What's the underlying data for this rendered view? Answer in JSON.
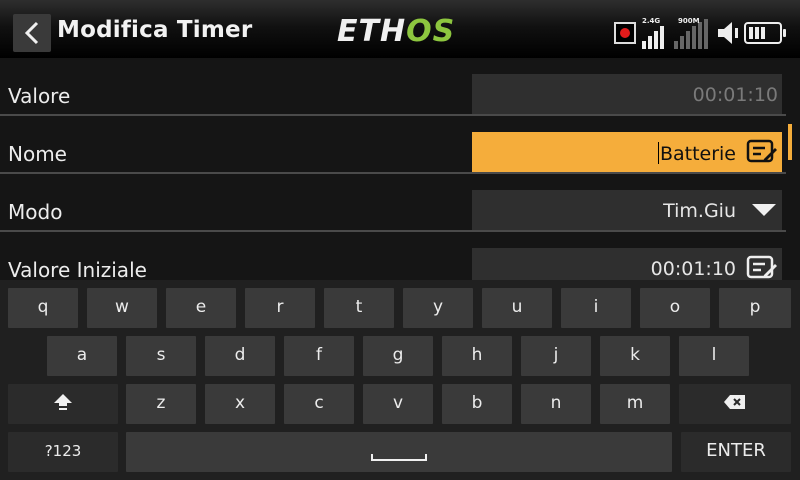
{
  "header": {
    "title": "Modifica Timer",
    "logo_part1": "ETH",
    "logo_part2": "OS",
    "signal1_label": "2.4G",
    "signal2_label": "900M"
  },
  "colors": {
    "accent": "#f5ad3b",
    "logo_green": "#8dc63f",
    "record": "#e41b1b"
  },
  "form": {
    "valore": {
      "label": "Valore",
      "value": "00:01:10"
    },
    "nome": {
      "label": "Nome",
      "value": "Batterie"
    },
    "modo": {
      "label": "Modo",
      "value": "Tim.Giu"
    },
    "valore_iniziale": {
      "label": "Valore Iniziale",
      "value": "00:01:10"
    }
  },
  "keyboard": {
    "row1": [
      "q",
      "w",
      "e",
      "r",
      "t",
      "y",
      "u",
      "i",
      "o",
      "p"
    ],
    "row2": [
      "a",
      "s",
      "d",
      "f",
      "g",
      "h",
      "j",
      "k",
      "l"
    ],
    "row3": [
      "z",
      "x",
      "c",
      "v",
      "b",
      "n",
      "m"
    ],
    "symbols_label": "?123",
    "enter_label": "ENTER",
    "shift_icon": "shift-icon",
    "backspace_icon": "backspace-icon",
    "space_icon": "space-icon"
  }
}
